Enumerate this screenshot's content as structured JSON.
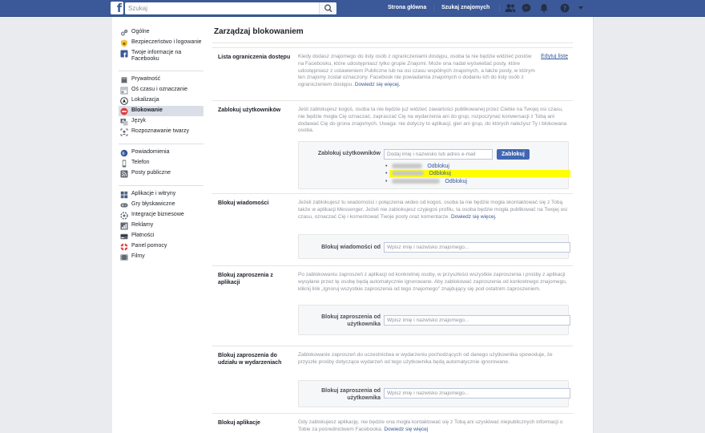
{
  "topbar": {
    "search_placeholder": "Szukaj",
    "nav_home": "Strona główna",
    "nav_find_friends": "Szukaj znajomych"
  },
  "icons": {
    "logo": "facebook-f-logo",
    "search": "magnifier-icon",
    "friends": "friends-icon",
    "messenger": "messenger-icon",
    "notifications": "bell-icon",
    "help": "question-icon",
    "menu": "caret-down-icon"
  },
  "colors": {
    "brand": "#3b5998",
    "link": "#365899",
    "button": "#4267b2",
    "highlight": "#ffff00"
  },
  "sidebar": {
    "groups": [
      [
        {
          "label": "Ogólne",
          "icon": "gears-icon"
        },
        {
          "label": "Bezpieczeństwo i logowanie",
          "icon": "shield-icon"
        },
        {
          "label": "Twoje informacje na Facebooku",
          "icon": "facebook-icon"
        }
      ],
      [
        {
          "label": "Prywatność",
          "icon": "lock-icon"
        },
        {
          "label": "Oś czasu i oznaczanie",
          "icon": "timeline-icon"
        },
        {
          "label": "Lokalizacja",
          "icon": "location-icon"
        },
        {
          "label": "Blokowanie",
          "icon": "block-icon",
          "active": true
        },
        {
          "label": "Język",
          "icon": "language-icon"
        },
        {
          "label": "Rozpoznawanie twarzy",
          "icon": "face-icon"
        }
      ],
      [
        {
          "label": "Powiadomienia",
          "icon": "globe-icon"
        },
        {
          "label": "Telefon",
          "icon": "phone-icon"
        },
        {
          "label": "Posty publiczne",
          "icon": "rss-icon"
        }
      ],
      [
        {
          "label": "Aplikacje i witryny",
          "icon": "apps-icon"
        },
        {
          "label": "Gry błyskawiczne",
          "icon": "gamepad-icon"
        },
        {
          "label": "Integracje biznesowe",
          "icon": "integration-icon"
        },
        {
          "label": "Reklamy",
          "icon": "ads-icon"
        },
        {
          "label": "Płatności",
          "icon": "card-icon"
        },
        {
          "label": "Panel pomocy",
          "icon": "lifebuoy-icon"
        },
        {
          "label": "Filmy",
          "icon": "film-icon"
        }
      ]
    ]
  },
  "main": {
    "title": "Zarządzaj blokowaniem",
    "restricted": {
      "label": "Lista ograniczenia dostępu",
      "desc": "Kiedy dodasz znajomego do listy osób z ograniczeniami dostępu, osoba ta nie będzie widzieć postów na Facebooku, które udostępniasz tylko grupie Znajomi. Może ona nadal wyświetlać posty, które udostępniasz z ustawieniem Publiczne lub na osi czasu wspólnych znajomych, a także posty, w którym ten znajomy został oznaczony. Facebook nie powiadamia znajomych o dodaniu ich do listy osób z ograniczeniem dostępu.",
      "learn_more": "Dowiedz się więcej.",
      "edit": "Edytuj listę"
    },
    "block_users": {
      "label": "Zablokuj użytkowników",
      "desc": "Jeśli zablokujesz kogoś, osoba ta nie będzie już widzieć zawartości publikowanej przez Ciebie na Twojej osi czasu, nie będzie mogła Cię oznaczać, zapraszać Cię na wydarzenia ani do grup, rozpoczynać konwersacji z Tobą ani dodawać Cię do grona znajomych. Uwaga: nie dotyczy to aplikacji, gier ani grup, do których należysz Ty i blokowana osoba.",
      "field_label": "Zablokuj użytkowników",
      "placeholder": "Dodaj imię i nazwisko lub adres e-mail",
      "button": "Zablokuj",
      "unblock": "Odblokuj",
      "blocked_count": 3
    },
    "block_messages": {
      "label": "Blokuj wiadomości",
      "desc": "Jeżeli zablokujesz tu wiadomości i połączenia wideo od kogoś, osoba ta nie będzie mogła skontaktować się z Tobą także w aplikacji Messenger. Jeżeli nie zablokujesz czyjegoś profilu, ta osoba będzie mogła publikować na Twojej osi czasu, oznaczać Cię i komentować Twoje posty oraz komentarze.",
      "learn_more": "Dowiedz się więcej.",
      "field_label": "Blokuj wiadomości od",
      "placeholder": "Wpisz imię i nazwisko znajomego..."
    },
    "block_app_invites": {
      "label": "Blokuj zaproszenia z aplikacji",
      "desc": "Po zablokowaniu zaproszeń z aplikacji od konkretnej osoby, w przyszłości wszystkie zaproszenia i prośby z aplikacji wysyłane przez tę osobę będą automatycznie ignorowane. Aby zablokować zaproszenia od konkretnego znajomego, kliknij link „Ignoruj wszystkie zaproszenia od tego znajomego” znajdujący się pod ostatnim zaproszeniem.",
      "field_label": "Blokuj zaproszenia od użytkownika",
      "placeholder": "Wpisz imię i nazwisko znajomego..."
    },
    "block_event_invites": {
      "label": "Blokuj zaproszenia do udziału w wydarzeniach",
      "desc": "Zablokowanie zaproszeń do uczestnictwa w wydarzeniu pochodzących od danego użytkownika spowoduje, że przyszłe prośby dotyczące wydarzeń od tego użytkownika będą automatycznie ignorowane.",
      "field_label": "Blokuj zaproszenia od użytkownika",
      "placeholder": "Wpisz imię i nazwisko znajomego..."
    },
    "block_apps": {
      "label": "Blokuj aplikacje",
      "desc": "Gdy zablokujesz aplikację, nie będzie ona mogła kontaktować się z Tobą ani uzyskiwać niepublicznych informacji o Tobie za pośrednictwem Facebooka.",
      "learn_more": "Dowiedz się więcej"
    }
  }
}
